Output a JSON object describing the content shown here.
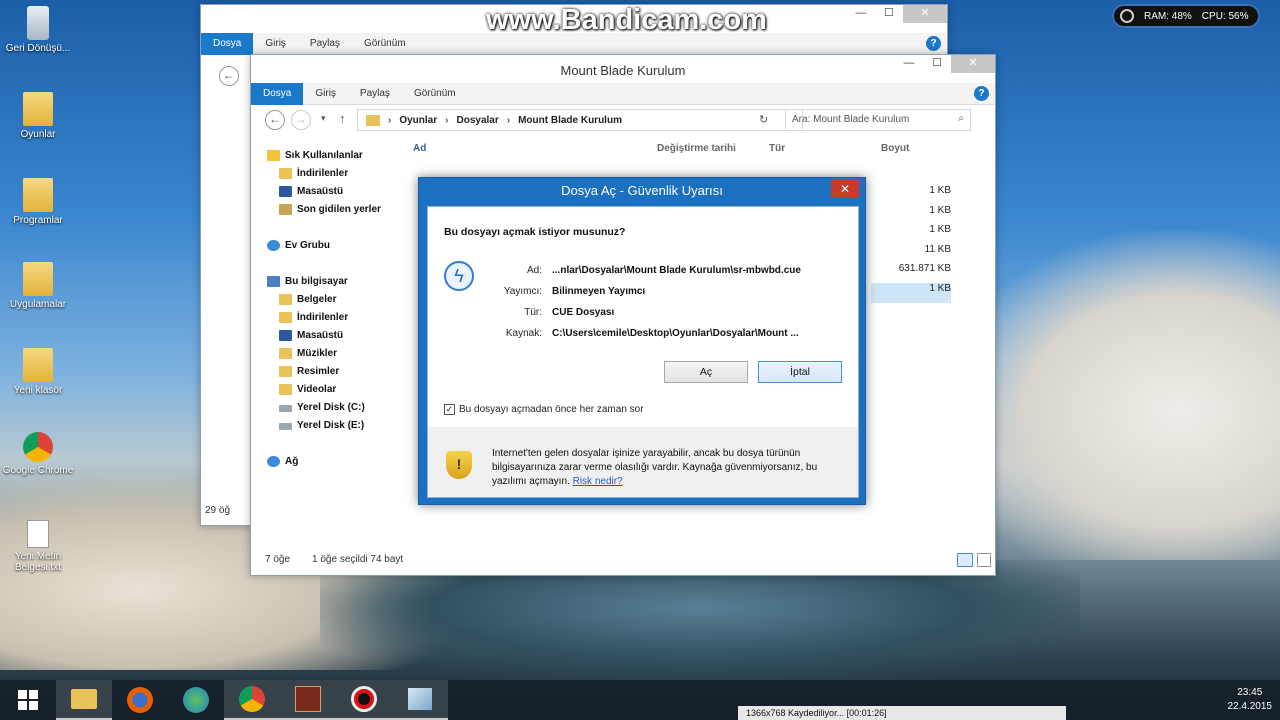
{
  "watermark": "www.Bandicam.com",
  "perf": {
    "ram": "RAM: 48%",
    "cpu": "CPU: 56%"
  },
  "desktop": [
    {
      "label": "Geri Dönüşü...",
      "icon": "recycle-bin-icon"
    },
    {
      "label": "Oyunlar",
      "icon": "folder-icon"
    },
    {
      "label": "Programlar",
      "icon": "folder-icon"
    },
    {
      "label": "Uygulamalar",
      "icon": "folder-icon"
    },
    {
      "label": "Yeni klasör",
      "icon": "folder-icon"
    },
    {
      "label": "Google Chrome",
      "icon": "chrome-icon"
    },
    {
      "label": "Yeni Metin Belgesi.txt",
      "icon": "text-file-icon"
    }
  ],
  "back_window": {
    "tabs": [
      "Dosya",
      "Giriş",
      "Paylaş",
      "Görünüm"
    ],
    "status": "29 öğ"
  },
  "explorer": {
    "title": "Mount Blade Kurulum",
    "tabs": [
      "Dosya",
      "Giriş",
      "Paylaş",
      "Görünüm"
    ],
    "breadcrumb": [
      "Oyunlar",
      "Dosyalar",
      "Mount Blade Kurulum"
    ],
    "search_placeholder": "Ara: Mount Blade Kurulum",
    "columns": [
      "Ad",
      "Değiştirme tarihi",
      "Tür",
      "Boyut"
    ],
    "sizes": [
      "1 KB",
      "1 KB",
      "1 KB",
      "11 KB",
      "631.871 KB",
      "1 KB"
    ],
    "nav": {
      "favorites": "Sık Kullanılanlar",
      "fav_items": [
        "İndirilenler",
        "Masaüstü",
        "Son gidilen yerler"
      ],
      "homegroup": "Ev Grubu",
      "pc": "Bu bilgisayar",
      "pc_items": [
        "Belgeler",
        "İndirilenler",
        "Masaüstü",
        "Müzikler",
        "Resimler",
        "Videolar",
        "Yerel Disk (C:)",
        "Yerel Disk (E:)"
      ],
      "network": "Ağ"
    },
    "status_count": "7 öğe",
    "status_selected": "1 öğe seçildi  74 bayt"
  },
  "dialog": {
    "title": "Dosya Aç - Güvenlik Uyarısı",
    "question": "Bu dosyayı açmak istiyor musunuz?",
    "fields": [
      {
        "k": "Ad:",
        "v": "...nlar\\Dosyalar\\Mount Blade Kurulum\\sr-mbwbd.cue"
      },
      {
        "k": "Yayımcı:",
        "v": "Bilinmeyen Yayımcı"
      },
      {
        "k": "Tür:",
        "v": "CUE Dosyası"
      },
      {
        "k": "Kaynak:",
        "v": "C:\\Users\\cemile\\Desktop\\Oyunlar\\Dosyalar\\Mount ..."
      }
    ],
    "open_button": "Aç",
    "cancel_button": "İptal",
    "checkbox_label": "Bu dosyayı açmadan önce her zaman sor",
    "checkbox_checked": true,
    "warning": "Internet'ten gelen dosyalar işinize yarayabilir, ancak bu dosya türünün bilgisayarınıza zarar verme olasılığı vardır. Kaynağa güvenmiyorsanız, bu yazılımı açmayın.",
    "risk_link": "Risk nedir?"
  },
  "taskbar": {
    "time": "23:45",
    "date": "22.4.2015",
    "recording": "1366x768   Kaydediliyor... [00:01:26]"
  }
}
